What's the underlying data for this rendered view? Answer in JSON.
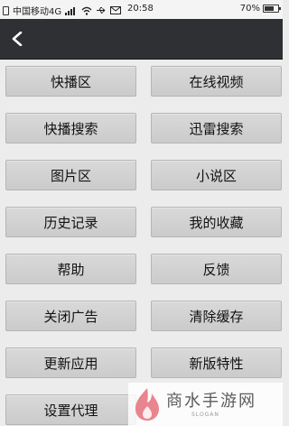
{
  "status_bar": {
    "carrier": "中国移动4G",
    "time": "20:58",
    "battery": "70%",
    "battery_level": 0.7,
    "icons": [
      "sim-icon",
      "signal-icon",
      "wifi-icon",
      "usb-icon",
      "mail-icon",
      "battery-icon"
    ]
  },
  "nav": {
    "back_icon": "chevron-left-icon"
  },
  "menu": [
    {
      "label": "快播区"
    },
    {
      "label": "在线视频"
    },
    {
      "label": "快播搜索"
    },
    {
      "label": "迅雷搜索"
    },
    {
      "label": "图片区"
    },
    {
      "label": "小说区"
    },
    {
      "label": "历史记录"
    },
    {
      "label": "我的收藏"
    },
    {
      "label": "帮助"
    },
    {
      "label": "反馈"
    },
    {
      "label": "关闭广告"
    },
    {
      "label": "清除缓存"
    },
    {
      "label": "更新应用"
    },
    {
      "label": "新版特性"
    },
    {
      "label": "设置代理"
    }
  ],
  "watermark": {
    "brand": "商水手游网",
    "slogan": "SLOGAN",
    "logo_icon": "flame-logo-icon"
  },
  "colors": {
    "nav_background": "#2e3033",
    "button_background": "#d3d3d3",
    "page_background": "#ececec",
    "watermark_logo": "#e8858e"
  }
}
